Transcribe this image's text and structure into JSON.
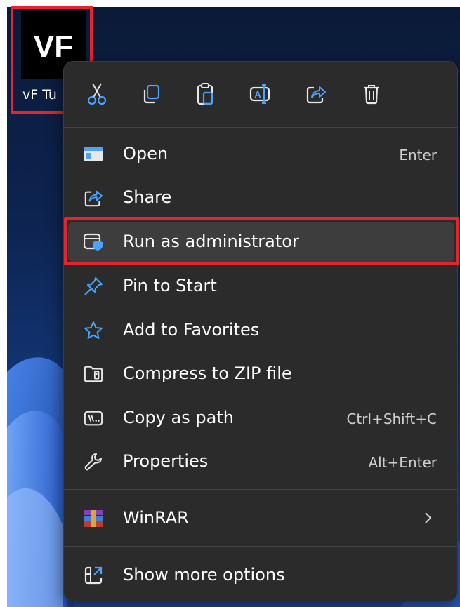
{
  "desktop": {
    "icon_logo_text": "VF",
    "icon_label": "vF Tu"
  },
  "quick_actions": [
    {
      "name": "cut-icon"
    },
    {
      "name": "copy-icon"
    },
    {
      "name": "paste-icon"
    },
    {
      "name": "rename-icon"
    },
    {
      "name": "share-icon"
    },
    {
      "name": "delete-icon"
    }
  ],
  "menu": {
    "items": [
      {
        "label": "Open",
        "shortcut": "Enter",
        "icon": "open-icon"
      },
      {
        "label": "Share",
        "shortcut": "",
        "icon": "share-icon"
      },
      {
        "label": "Run as administrator",
        "shortcut": "",
        "icon": "run-as-admin-icon",
        "highlighted": true
      },
      {
        "label": "Pin to Start",
        "shortcut": "",
        "icon": "pin-icon"
      },
      {
        "label": "Add to Favorites",
        "shortcut": "",
        "icon": "star-icon"
      },
      {
        "label": "Compress to ZIP file",
        "shortcut": "",
        "icon": "zip-icon"
      },
      {
        "label": "Copy as path",
        "shortcut": "Ctrl+Shift+C",
        "icon": "copy-path-icon"
      },
      {
        "label": "Properties",
        "shortcut": "Alt+Enter",
        "icon": "wrench-icon"
      },
      {
        "label": "WinRAR",
        "shortcut": "",
        "icon": "winrar-icon",
        "submenu": true
      },
      {
        "label": "Show more options",
        "shortcut": "",
        "icon": "more-options-icon"
      }
    ]
  },
  "colors": {
    "menu_bg": "#2b2b2b",
    "highlight": "#3d3d3d",
    "annotation_red": "#e3262e",
    "accent_blue": "#4aa3ff"
  }
}
